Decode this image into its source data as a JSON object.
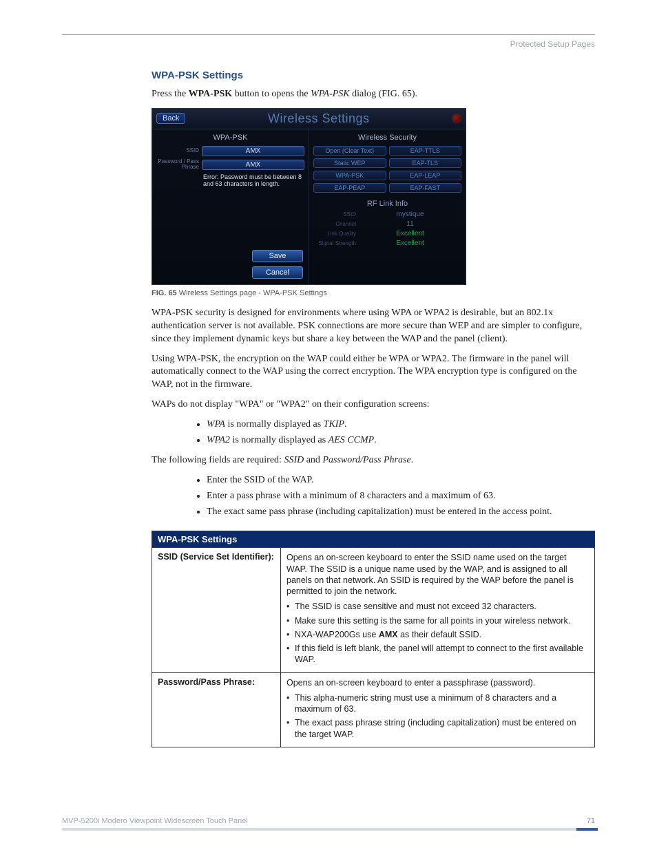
{
  "header": {
    "section": "Protected Setup Pages"
  },
  "title": "WPA-PSK Settings",
  "intro": {
    "pre": "Press the ",
    "bold": "WPA-PSK",
    "mid": " button to opens the ",
    "ital": "WPA-PSK",
    "post": " dialog (FIG. 65)."
  },
  "figure": {
    "back": "Back",
    "title": "Wireless Settings",
    "left_label": "WPA-PSK",
    "ssid_label": "SSID",
    "ssid_value": "AMX",
    "pw_label": "Password / Pass Phrase",
    "pw_value": "AMX",
    "error": "Error: Password must be between 8 and 63 characters in length.",
    "save": "Save",
    "cancel": "Cancel",
    "right_label": "Wireless Security",
    "sec_options": [
      "Open (Clear Text)",
      "EAP-TTLS",
      "Static WEP",
      "EAP-TLS",
      "WPA-PSK",
      "EAP-LEAP",
      "EAP-PEAP",
      "EAP-FAST"
    ],
    "rf_label": "RF Link Info",
    "rf_rows": [
      {
        "k": "SSID",
        "v": "mystique",
        "cls": "rf-text"
      },
      {
        "k": "Channel",
        "v": "11",
        "cls": "rf-text"
      },
      {
        "k": "Link Quality",
        "v": "Excellent",
        "cls": "rf-green"
      },
      {
        "k": "Signal Strength",
        "v": "Excellent",
        "cls": "rf-green"
      }
    ]
  },
  "caption": {
    "bold": "FIG. 65",
    "text": "  Wireless Settings page - WPA-PSK Settings"
  },
  "para1": "WPA-PSK security is designed for environments where using WPA or WPA2 is desirable, but an 802.1x authentication server is not available. PSK connections are more secure than WEP and are simpler to configure, since they implement dynamic keys but share a key between the WAP and the panel (client).",
  "para2": "Using WPA-PSK, the encryption on the WAP could either be WPA or WPA2. The firmware in the panel will automatically connect to the WAP using the correct encryption. The WPA encryption type is configured on the WAP, not in the firmware.",
  "para3": "WAPs do not display \"WPA\" or \"WPA2\" on their configuration screens:",
  "list1": [
    {
      "em": "WPA",
      "rest": " is normally displayed as ",
      "em2": "TKIP",
      "tail": "."
    },
    {
      "em": "WPA2",
      "rest": " is normally displayed as ",
      "em2": "AES CCMP",
      "tail": "."
    }
  ],
  "para4": {
    "pre": "The following fields are required: ",
    "em1": "SSID",
    "mid": " and ",
    "em2": "Password/Pass Phrase",
    "post": "."
  },
  "list2": [
    "Enter the SSID of the WAP.",
    "Enter a pass phrase with a minimum of 8 characters and a maximum of 63.",
    "The exact same pass phrase (including capitalization) must be entered in the access point."
  ],
  "table": {
    "title": "WPA-PSK Settings",
    "rows": [
      {
        "key": "SSID (Service Set Identifier):",
        "lead": "Opens an on-screen keyboard to enter the SSID name used on the target WAP. The SSID is a unique name used by the WAP, and is assigned to all panels on that network. An SSID is required by the WAP before the panel is permitted to join the network.",
        "bullets": [
          {
            "text": "The SSID is case sensitive and must not exceed 32 characters."
          },
          {
            "text": "Make sure this setting is the same for all points in your wireless network."
          },
          {
            "pre": "NXA-WAP200Gs use ",
            "bold": "AMX",
            "post": " as their default SSID."
          },
          {
            "text": "If this field is left blank, the panel will attempt to connect to the first available WAP."
          }
        ]
      },
      {
        "key": "Password/Pass Phrase:",
        "lead": "Opens an on-screen keyboard to enter a passphrase (password).",
        "bullets": [
          {
            "text": "This alpha-numeric string must use a minimum of 8 characters and a maximum of 63."
          },
          {
            "text": "The exact pass phrase string (including capitalization) must be entered on the target WAP."
          }
        ]
      }
    ]
  },
  "footer": {
    "product": "MVP-5200i Modero Viewpoint Widescreen Touch Panel",
    "page": "71"
  }
}
